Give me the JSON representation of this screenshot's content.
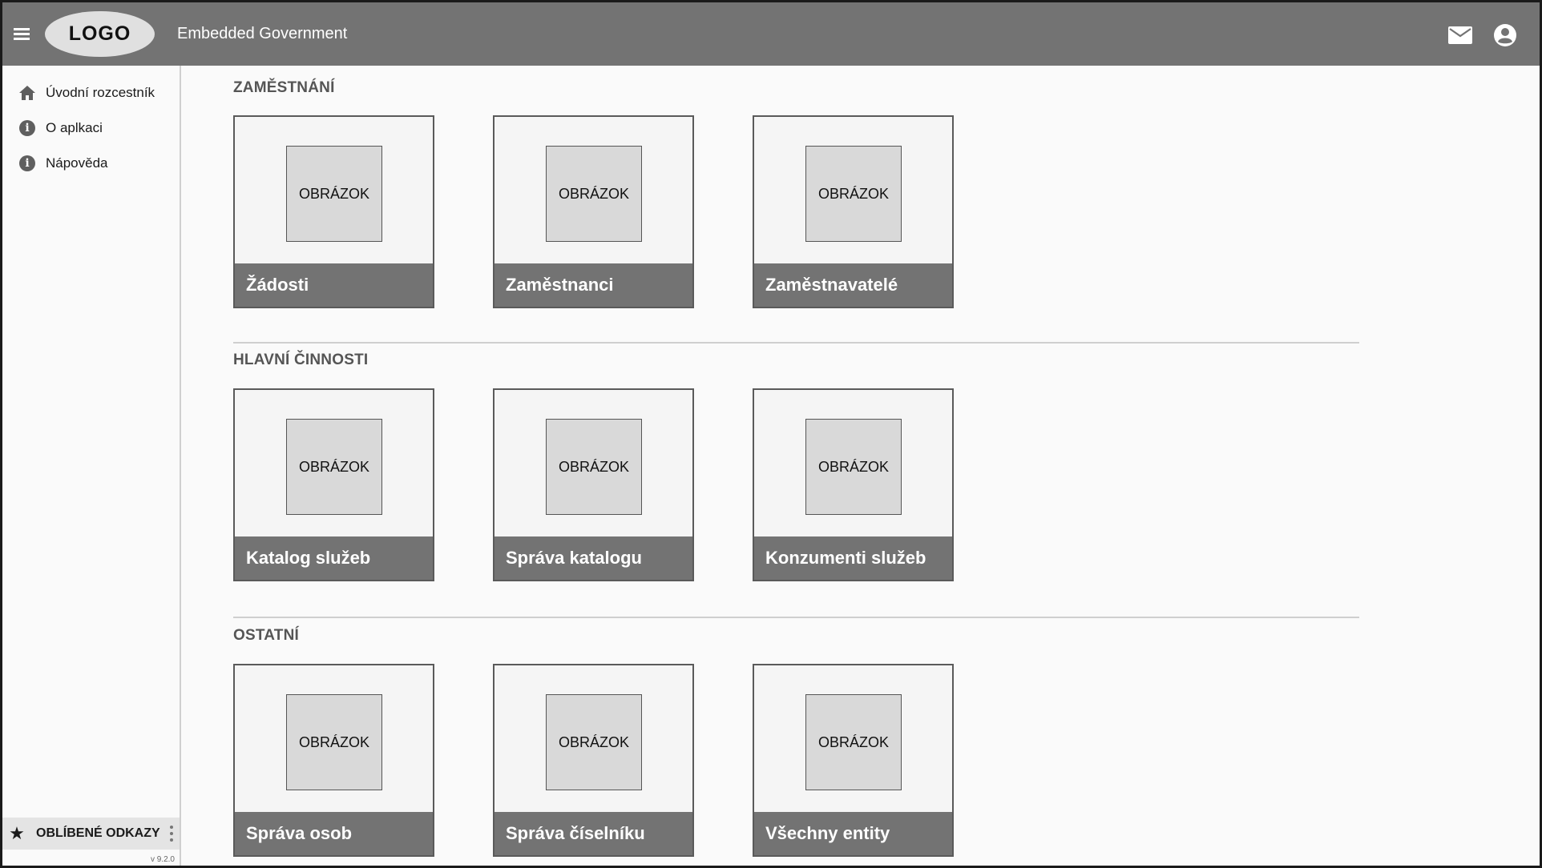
{
  "header": {
    "logo_text": "LOGO",
    "app_title": "Embedded Government"
  },
  "sidebar": {
    "items": [
      {
        "label": "Úvodní rozcestník",
        "icon": "home-icon"
      },
      {
        "label": "O aplkaci",
        "icon": "info-icon"
      },
      {
        "label": "Nápověda",
        "icon": "info-icon"
      }
    ],
    "favorites_label": "OBLÍBENÉ ODKAZY",
    "version": "v 9.2.0"
  },
  "sections": [
    {
      "title": "ZAMĚSTNÁNÍ",
      "cards": [
        {
          "image_label": "OBRÁZOK",
          "label": "Žádosti"
        },
        {
          "image_label": "OBRÁZOK",
          "label": "Zaměstnanci"
        },
        {
          "image_label": "OBRÁZOK",
          "label": "Zaměstnavatelé"
        }
      ]
    },
    {
      "title": "HLAVNÍ ČINNOSTI",
      "cards": [
        {
          "image_label": "OBRÁZOK",
          "label": "Katalog služeb"
        },
        {
          "image_label": "OBRÁZOK",
          "label": "Správa katalogu"
        },
        {
          "image_label": "OBRÁZOK",
          "label": "Konzumenti služeb"
        }
      ]
    },
    {
      "title": "OSTATNÍ",
      "cards": [
        {
          "image_label": "OBRÁZOK",
          "label": "Správa osob"
        },
        {
          "image_label": "OBRÁZOK",
          "label": "Správa číselníku"
        },
        {
          "image_label": "OBRÁZOK",
          "label": "Všechny entity"
        }
      ]
    }
  ],
  "colors": {
    "header_bg": "#737373",
    "card_footer_bg": "#737373",
    "thumb_bg": "#d9d9d9"
  }
}
